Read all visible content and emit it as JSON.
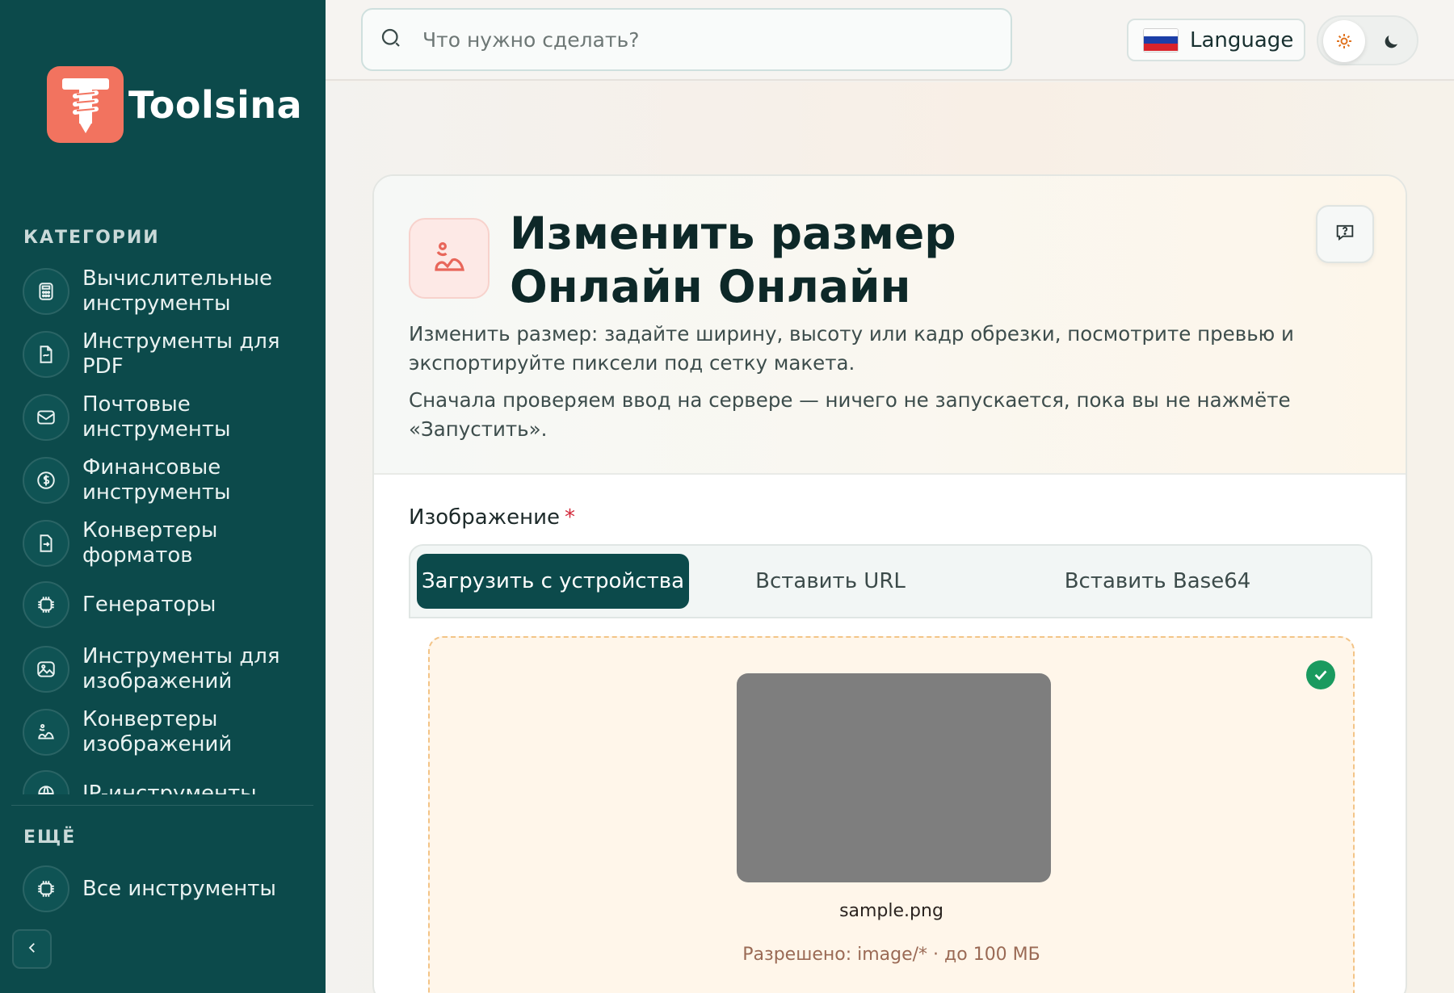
{
  "brand": {
    "name": "Toolsina"
  },
  "sidebar": {
    "categories_title": "КАТЕГОРИИ",
    "items": [
      {
        "label": "Вычислительные инструменты",
        "icon": "calculator-icon"
      },
      {
        "label": "Инструменты для PDF",
        "icon": "file-icon"
      },
      {
        "label": "Почтовые инструменты",
        "icon": "mail-icon"
      },
      {
        "label": "Финансовые инструменты",
        "icon": "dollar-icon"
      },
      {
        "label": "Конвертеры форматов",
        "icon": "convert-icon"
      },
      {
        "label": "Генераторы",
        "icon": "cpu-icon"
      },
      {
        "label": "Инструменты для изображений",
        "icon": "image-icon"
      },
      {
        "label": "Конвертеры изображений",
        "icon": "image-convert-icon"
      },
      {
        "label": "IP-инструменты",
        "icon": "network-icon"
      }
    ],
    "more_title": "ЕЩЁ",
    "all_tools": "Все инструменты"
  },
  "topbar": {
    "search_placeholder": "Что нужно сделать?",
    "language_label": "Language"
  },
  "tool": {
    "title": "Изменить размер Онлайн Онлайн",
    "desc1": "Изменить размер: задайте ширину, высоту или кадр обрезки, посмотрите превью и экспортируйте пиксели под сетку макета.",
    "desc2": "Сначала проверяем ввод на сервере — ничего не запускается, пока вы не нажмёте «Запустить»."
  },
  "form": {
    "image_label": "Изображение",
    "required_mark": "*",
    "tabs": [
      "Загрузить с устройства",
      "Вставить URL",
      "Вставить Base64"
    ],
    "file_name": "sample.png",
    "allowed": "Разрешено: image/* · до 100 МБ"
  },
  "colors": {
    "sidebar": "#0c4a4b",
    "brand_accent": "#f2735f",
    "success": "#1a9a5f"
  }
}
